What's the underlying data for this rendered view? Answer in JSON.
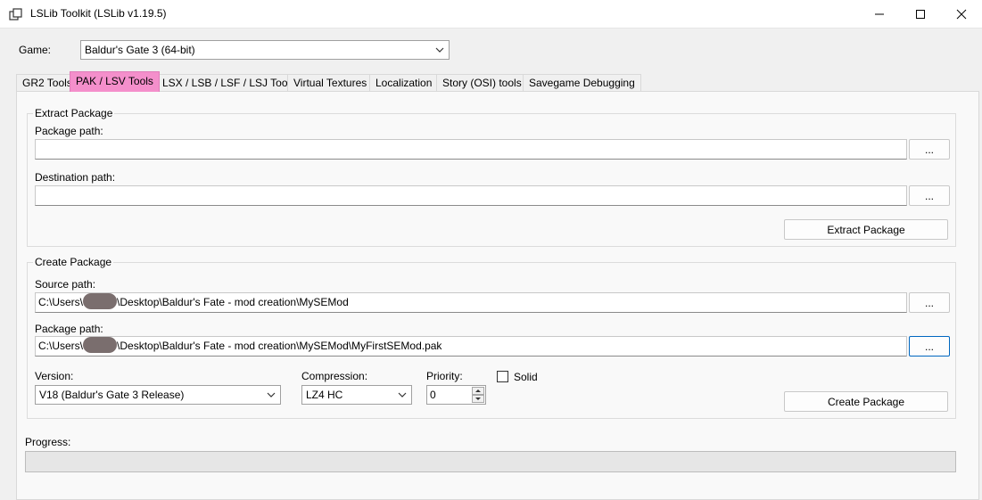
{
  "window": {
    "title": "LSLib Toolkit (LSLib v1.19.5)",
    "icons": {
      "app": "window-stack-icon",
      "minimize": "minimize-icon",
      "maximize": "maximize-icon",
      "close": "close-icon"
    }
  },
  "game": {
    "label": "Game:",
    "selected": "Baldur's Gate 3 (64-bit)"
  },
  "tabs": [
    {
      "label": "GR2 Tools"
    },
    {
      "label": "PAK / LSV Tools",
      "active": true
    },
    {
      "label": "LSX / LSB / LSF / LSJ Tools"
    },
    {
      "label": "Virtual Textures"
    },
    {
      "label": "Localization"
    },
    {
      "label": "Story (OSI) tools"
    },
    {
      "label": "Savegame Debugging"
    }
  ],
  "tab_highlight_color": "#f48fcb",
  "extract": {
    "title": "Extract Package",
    "package_path_label": "Package path:",
    "package_path_value": "",
    "destination_path_label": "Destination path:",
    "destination_path_value": "",
    "browse_label": "...",
    "button_label": "Extract Package"
  },
  "create": {
    "title": "Create Package",
    "source_path_label": "Source path:",
    "source_path_prefix": "C:\\Users\\",
    "source_path_suffix": "\\Desktop\\Baldur's Fate - mod creation\\MySEMod",
    "package_path_label": "Package path:",
    "package_path_prefix": "C:\\Users\\",
    "package_path_suffix": "\\Desktop\\Baldur's Fate - mod creation\\MySEMod\\MyFirstSEMod.pak",
    "browse_label": "...",
    "version_label": "Version:",
    "version_selected": "V18 (Baldur's Gate 3 Release)",
    "compression_label": "Compression:",
    "compression_selected": "LZ4 HC",
    "priority_label": "Priority:",
    "priority_value": "0",
    "solid_label": "Solid",
    "solid_checked": false,
    "button_label": "Create Package"
  },
  "progress": {
    "label": "Progress:",
    "value": 0
  }
}
